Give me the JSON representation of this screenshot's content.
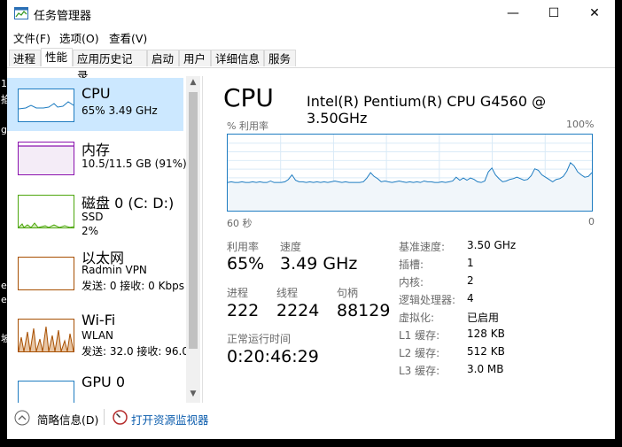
{
  "window": {
    "title": "任务管理器",
    "minimize_glyph": "—",
    "maximize_glyph": "☐",
    "close_glyph": "✕"
  },
  "menu": [
    "文件(F)",
    "选项(O)",
    "查看(V)"
  ],
  "tabs": [
    "进程",
    "性能",
    "应用历史记录",
    "启动",
    "用户",
    "详细信息",
    "服务"
  ],
  "active_tab": "性能",
  "resources": [
    {
      "name": "CPU",
      "line1": "65% 3.49 GHz",
      "line2": "",
      "color": "#1e7cc1"
    },
    {
      "name": "内存",
      "line1": "10.5/11.5 GB (91%)",
      "line2": "",
      "color": "#8b12ae"
    },
    {
      "name": "磁盘 0 (C: D:)",
      "line1": "SSD",
      "line2": "2%",
      "color": "#4da60c"
    },
    {
      "name": "以太网",
      "line1": "Radmin VPN",
      "line2": "发送: 0 接收: 0 Kbps",
      "color": "#a74f01"
    },
    {
      "name": "Wi-Fi",
      "line1": "WLAN",
      "line2": "发送: 32.0 接收: 96.0",
      "color": "#a74f01"
    },
    {
      "name": "GPU 0",
      "line1": "",
      "line2": "",
      "color": "#1e7cc1"
    }
  ],
  "detail": {
    "title": "CPU",
    "model": "Intel(R) Pentium(R) CPU G4560 @ 3.50GHz",
    "graph_label": "% 利用率",
    "graph_max": "100%",
    "graph_time": "60 秒",
    "graph_zero": "0",
    "utilization_label": "利用率",
    "utilization": "65%",
    "speed_label": "速度",
    "speed": "3.49 GHz",
    "processes_label": "进程",
    "processes": "222",
    "threads_label": "线程",
    "threads": "2224",
    "handles_label": "句柄",
    "handles": "88129",
    "uptime_label": "正常运行时间",
    "uptime": "0:20:46:29",
    "specs": [
      {
        "label": "基准速度:",
        "value": "3.50 GHz"
      },
      {
        "label": "插槽:",
        "value": "1"
      },
      {
        "label": "内核:",
        "value": "2"
      },
      {
        "label": "逻辑处理器:",
        "value": "4"
      },
      {
        "label": "虚拟化:",
        "value": "已启用"
      },
      {
        "label": "L1 缓存:",
        "value": "128 KB"
      },
      {
        "label": "L2 缓存:",
        "value": "512 KB"
      },
      {
        "label": "L3 缓存:",
        "value": "3.0 MB"
      }
    ],
    "cpu_history_percent": [
      37,
      38,
      37,
      37,
      38,
      37,
      37,
      38,
      37,
      38,
      37,
      37,
      39,
      37,
      37,
      37,
      38,
      41,
      47,
      40,
      38,
      38,
      37,
      38,
      37,
      38,
      37,
      38,
      37,
      38,
      39,
      38,
      37,
      38,
      37,
      37,
      37,
      37,
      38,
      43,
      50,
      45,
      42,
      38,
      39,
      38,
      37,
      38,
      39,
      38,
      37,
      38,
      37,
      38,
      37,
      39,
      38,
      38,
      37,
      37,
      38,
      37,
      38,
      39,
      44,
      40,
      43,
      40,
      43,
      41,
      38,
      37,
      39,
      51,
      56,
      47,
      42,
      38,
      39,
      41,
      42,
      44,
      42,
      40,
      41,
      46,
      55,
      53,
      47,
      44,
      41,
      38,
      41,
      42,
      45,
      52,
      63,
      59,
      51,
      47,
      44,
      45,
      50
    ]
  },
  "footer": {
    "summary": "简略信息(D)",
    "monitor": "打开资源监视器"
  },
  "bg_chars": [
    "1",
    "掐",
    "g",
    "e",
    "e",
    "坡"
  ]
}
